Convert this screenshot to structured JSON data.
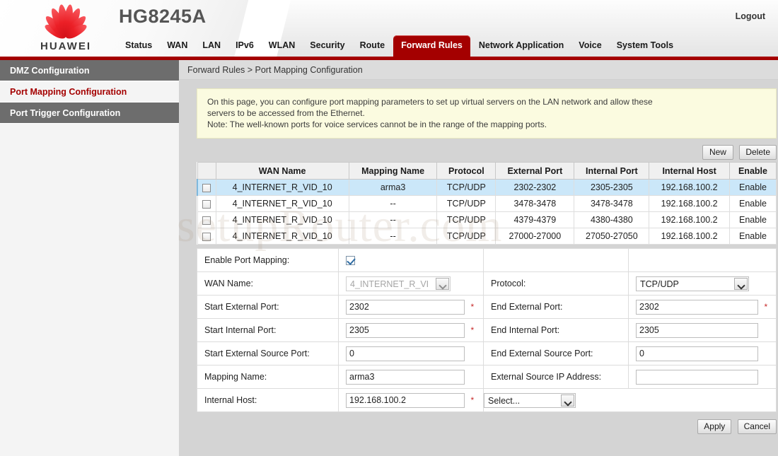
{
  "header": {
    "brand": "HUAWEI",
    "model": "HG8245A",
    "logout_label": "Logout",
    "accent_color": "#a40000",
    "nav": [
      {
        "label": "Status",
        "active": false
      },
      {
        "label": "WAN",
        "active": false
      },
      {
        "label": "LAN",
        "active": false
      },
      {
        "label": "IPv6",
        "active": false
      },
      {
        "label": "WLAN",
        "active": false
      },
      {
        "label": "Security",
        "active": false
      },
      {
        "label": "Route",
        "active": false
      },
      {
        "label": "Forward Rules",
        "active": true
      },
      {
        "label": "Network Application",
        "active": false
      },
      {
        "label": "Voice",
        "active": false
      },
      {
        "label": "System Tools",
        "active": false
      }
    ]
  },
  "sidebar": {
    "items": [
      {
        "label": "DMZ Configuration",
        "active": false
      },
      {
        "label": "Port Mapping Configuration",
        "active": true
      },
      {
        "label": "Port Trigger Configuration",
        "active": false
      }
    ]
  },
  "breadcrumb": "Forward Rules > Port Mapping Configuration",
  "notice": {
    "line1": "On this page, you can configure port mapping parameters to set up virtual servers on the LAN network and allow these",
    "line2": "servers to be accessed from the Ethernet.",
    "line3": "Note: The well-known ports for voice services cannot be in the range of the mapping ports."
  },
  "toolbar": {
    "new_label": "New",
    "delete_label": "Delete"
  },
  "table": {
    "headers": [
      "WAN Name",
      "Mapping Name",
      "Protocol",
      "External Port",
      "Internal Port",
      "Internal Host",
      "Enable"
    ],
    "rows": [
      {
        "selected": true,
        "checked": false,
        "wan_name": "4_INTERNET_R_VID_10",
        "mapping_name": "arma3",
        "protocol": "TCP/UDP",
        "external_port": "2302-2302",
        "internal_port": "2305-2305",
        "internal_host": "192.168.100.2",
        "enable": "Enable"
      },
      {
        "selected": false,
        "checked": false,
        "wan_name": "4_INTERNET_R_VID_10",
        "mapping_name": "--",
        "protocol": "TCP/UDP",
        "external_port": "3478-3478",
        "internal_port": "3478-3478",
        "internal_host": "192.168.100.2",
        "enable": "Enable"
      },
      {
        "selected": false,
        "checked": false,
        "wan_name": "4_INTERNET_R_VID_10",
        "mapping_name": "--",
        "protocol": "TCP/UDP",
        "external_port": "4379-4379",
        "internal_port": "4380-4380",
        "internal_host": "192.168.100.2",
        "enable": "Enable"
      },
      {
        "selected": false,
        "checked": false,
        "wan_name": "4_INTERNET_R_VID_10",
        "mapping_name": "--",
        "protocol": "TCP/UDP",
        "external_port": "27000-27000",
        "internal_port": "27050-27050",
        "internal_host": "192.168.100.2",
        "enable": "Enable"
      }
    ]
  },
  "form": {
    "enable_port_mapping_label": "Enable Port Mapping:",
    "enable_port_mapping_checked": true,
    "wan_name_label": "WAN Name:",
    "wan_name_value": "4_INTERNET_R_VI",
    "protocol_label": "Protocol:",
    "protocol_value": "TCP/UDP",
    "start_external_port_label": "Start External Port:",
    "start_external_port_value": "2302",
    "end_external_port_label": "End External Port:",
    "end_external_port_value": "2302",
    "start_internal_port_label": "Start Internal Port:",
    "start_internal_port_value": "2305",
    "end_internal_port_label": "End Internal Port:",
    "end_internal_port_value": "2305",
    "start_external_source_port_label": "Start External Source Port:",
    "start_external_source_port_value": "0",
    "end_external_source_port_label": "End External Source Port:",
    "end_external_source_port_value": "0",
    "mapping_name_label": "Mapping Name:",
    "mapping_name_value": "arma3",
    "external_source_ip_label": "External Source IP Address:",
    "external_source_ip_value": "",
    "internal_host_label": "Internal Host:",
    "internal_host_value": "192.168.100.2",
    "internal_host_select_value": "Select...",
    "required_marker": "*",
    "apply_label": "Apply",
    "cancel_label": "Cancel"
  },
  "watermark": "setupRouter.com"
}
